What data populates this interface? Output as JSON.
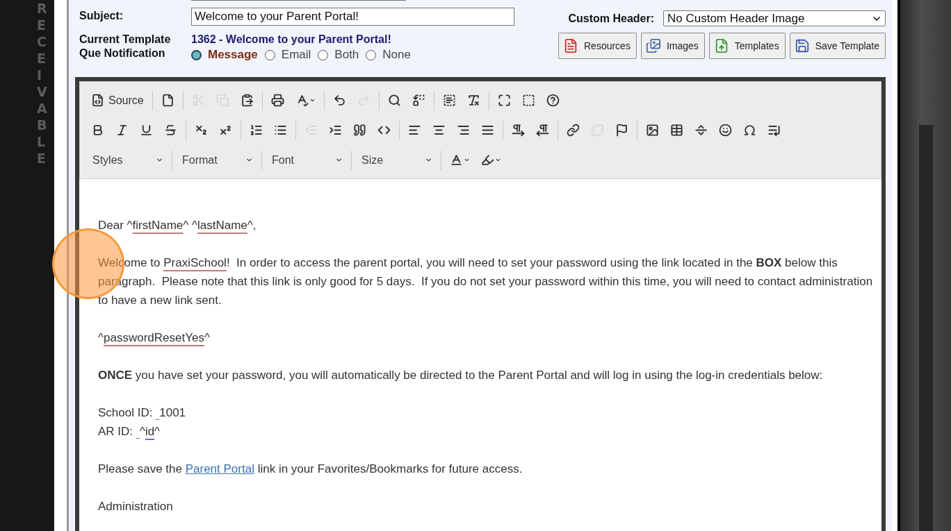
{
  "sidebar": {
    "label": "RECEIVABLE"
  },
  "form": {
    "subject": {
      "label": "Subject:",
      "value": "Welcome to your Parent Portal!"
    },
    "template": {
      "label": "Current Template",
      "name": "1362 - Welcome to your Parent Portal!"
    },
    "notification": {
      "label": "Que Notification",
      "options": [
        {
          "label": "Message",
          "selected": true
        },
        {
          "label": "Email",
          "selected": false
        },
        {
          "label": "Both",
          "selected": false
        },
        {
          "label": "None",
          "selected": false
        }
      ]
    },
    "custom_header": {
      "label": "Custom Header:",
      "value": "No Custom Header Image"
    },
    "buttons": [
      {
        "label": "Resources",
        "kind": "pdf"
      },
      {
        "label": "Images",
        "kind": "images"
      },
      {
        "label": "Templates",
        "kind": "template"
      },
      {
        "label": "Save Template",
        "kind": "save"
      }
    ]
  },
  "editor": {
    "toolbar": [
      [
        [
          {
            "kind": "source",
            "label": "Source",
            "disabled": false
          }
        ],
        [
          {
            "kind": "newpage",
            "disabled": false
          }
        ],
        [
          {
            "kind": "cut",
            "disabled": true
          },
          {
            "kind": "copy",
            "disabled": true
          },
          {
            "kind": "paste",
            "disabled": false
          }
        ],
        [
          {
            "kind": "print",
            "disabled": false
          },
          {
            "kind": "spellcheck",
            "disabled": false
          }
        ],
        [
          {
            "kind": "undo",
            "disabled": false
          },
          {
            "kind": "redo",
            "disabled": true
          }
        ],
        [
          {
            "kind": "find",
            "disabled": false
          },
          {
            "kind": "replace",
            "disabled": false
          }
        ],
        [
          {
            "kind": "selectall",
            "disabled": false
          },
          {
            "kind": "removeformat",
            "disabled": false
          }
        ],
        [
          {
            "kind": "maximize",
            "disabled": false
          },
          {
            "kind": "showblocks",
            "disabled": false
          },
          {
            "kind": "help",
            "disabled": false
          }
        ]
      ],
      [
        [
          {
            "kind": "bold",
            "disabled": false
          },
          {
            "kind": "italic",
            "disabled": false
          },
          {
            "kind": "underline",
            "disabled": false
          },
          {
            "kind": "strike",
            "disabled": false
          }
        ],
        [
          {
            "kind": "subscript",
            "disabled": false
          },
          {
            "kind": "superscript",
            "disabled": false
          }
        ],
        [
          {
            "kind": "ol",
            "disabled": false
          },
          {
            "kind": "ul",
            "disabled": false
          }
        ],
        [
          {
            "kind": "outdent",
            "disabled": true
          },
          {
            "kind": "indent",
            "disabled": false
          },
          {
            "kind": "blockquote",
            "disabled": false
          },
          {
            "kind": "div",
            "disabled": false
          }
        ],
        [
          {
            "kind": "alignleft",
            "disabled": false
          },
          {
            "kind": "aligncenter",
            "disabled": false
          },
          {
            "kind": "alignright",
            "disabled": false
          },
          {
            "kind": "justify",
            "disabled": false
          }
        ],
        [
          {
            "kind": "ltr",
            "disabled": false
          },
          {
            "kind": "rtl",
            "disabled": false
          }
        ],
        [
          {
            "kind": "link",
            "disabled": false
          },
          {
            "kind": "unlink",
            "disabled": true
          },
          {
            "kind": "anchor",
            "disabled": false
          }
        ],
        [
          {
            "kind": "image",
            "disabled": false
          },
          {
            "kind": "table",
            "disabled": false
          },
          {
            "kind": "hr",
            "disabled": false
          },
          {
            "kind": "smiley",
            "disabled": false
          },
          {
            "kind": "specialchar",
            "disabled": false
          },
          {
            "kind": "pagebreak",
            "disabled": false
          }
        ]
      ],
      [
        [
          {
            "kind": "combo",
            "label": "Styles",
            "disabled": false
          }
        ],
        [
          {
            "kind": "combo",
            "label": "Format",
            "disabled": false
          }
        ],
        [
          {
            "kind": "combo",
            "label": "Font",
            "disabled": false
          }
        ],
        [
          {
            "kind": "combo",
            "label": "Size",
            "disabled": false
          }
        ],
        [
          {
            "kind": "textcolor",
            "disabled": false
          },
          {
            "kind": "bgcolor",
            "disabled": false
          }
        ]
      ]
    ],
    "body": [
      {
        "kind": "blank"
      },
      {
        "kind": "text",
        "lines": [
          [
            {
              "text": "Dear ^",
              "kind": "plain"
            },
            {
              "text": "firstName",
              "kind": "misspelled"
            },
            {
              "text": "^ ^",
              "kind": "plain"
            },
            {
              "text": "lastName",
              "kind": "misspelled"
            },
            {
              "text": "^,",
              "kind": "plain"
            }
          ]
        ]
      },
      {
        "kind": "text",
        "lines": [
          [
            {
              "text": "Welcome to ",
              "kind": "plain"
            },
            {
              "text": "PraxiSchool",
              "kind": "misspelled"
            },
            {
              "text": "!  In order to access the parent portal, you will need to set your password using the link located in the ",
              "kind": "plain"
            },
            {
              "text": "BOX",
              "kind": "bold"
            },
            {
              "text": " below this paragraph.  Please note that this link is only good for 5 days.  If you do not set your password within this time, you will need to contact administration to have a new link sent.",
              "kind": "plain"
            }
          ]
        ]
      },
      {
        "kind": "text",
        "lines": [
          [
            {
              "text": "^",
              "kind": "plain"
            },
            {
              "text": "passwordResetYes",
              "kind": "misspelled"
            },
            {
              "text": "^",
              "kind": "plain"
            }
          ]
        ]
      },
      {
        "kind": "blank"
      },
      {
        "kind": "text",
        "lines": [
          [
            {
              "text": "ONCE",
              "kind": "bold"
            },
            {
              "text": " you have set your password, you will automatically be directed to the Parent Portal and will log in using the log-in credentials below:",
              "kind": "plain"
            }
          ]
        ]
      },
      {
        "kind": "text",
        "lines": [
          [
            {
              "text": "School ID: ",
              "kind": "plain"
            },
            {
              "kind": "gap"
            },
            {
              "text": "1001",
              "kind": "plain"
            }
          ],
          [
            {
              "text": "AR ID: ",
              "kind": "plain"
            },
            {
              "kind": "gap"
            },
            {
              "text": "^",
              "kind": "plain"
            },
            {
              "text": "id",
              "kind": "marked"
            },
            {
              "text": "^",
              "kind": "plain"
            }
          ]
        ]
      },
      {
        "kind": "text",
        "lines": [
          [
            {
              "text": "Please save the ",
              "kind": "plain"
            },
            {
              "text": "Parent Portal",
              "kind": "link"
            },
            {
              "text": " link in your Favorites/Bookmarks for future access.",
              "kind": "plain"
            }
          ]
        ]
      },
      {
        "kind": "text",
        "lines": [
          [
            {
              "text": "Administration",
              "kind": "plain"
            }
          ]
        ]
      }
    ]
  }
}
